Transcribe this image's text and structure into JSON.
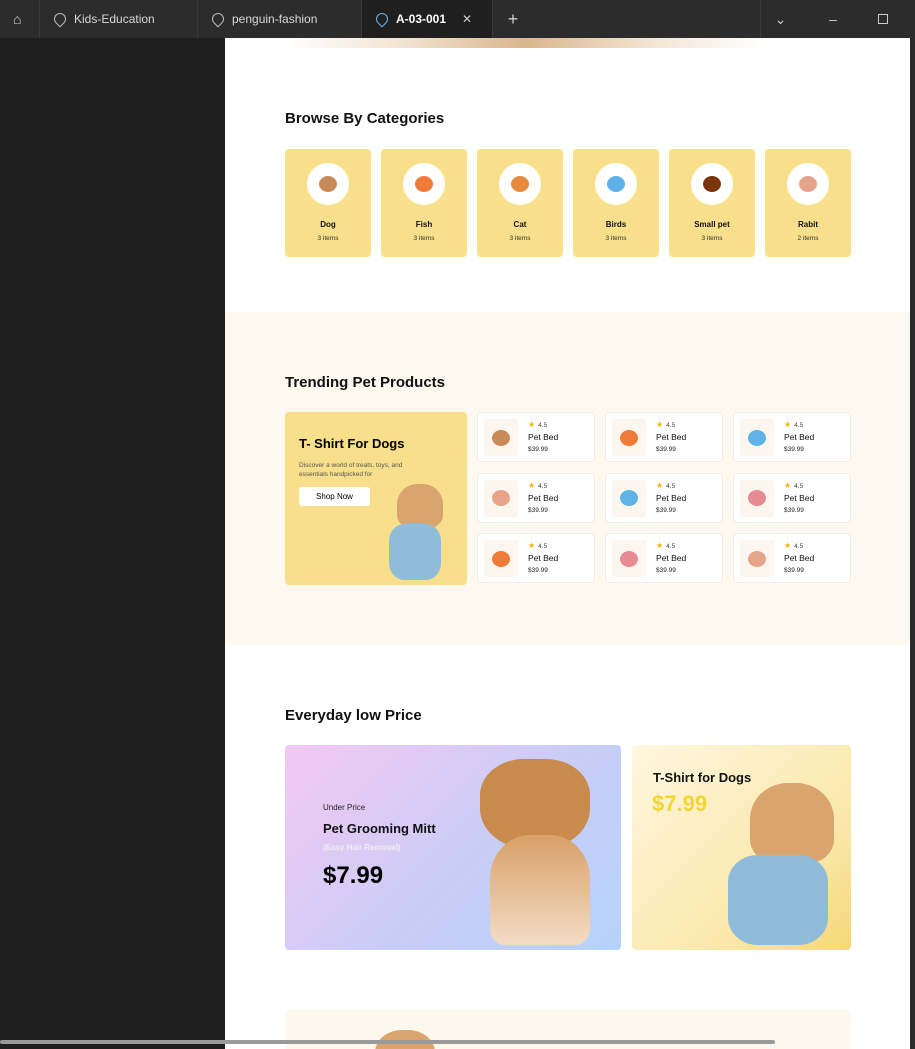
{
  "tabs": [
    {
      "label": "Kids-Education"
    },
    {
      "label": "penguin-fashion"
    },
    {
      "label": "A-03-001",
      "active": true
    }
  ],
  "categories": {
    "title": "Browse By Categories",
    "items": [
      {
        "name": "Dog",
        "count": "3 items",
        "color": "#c98a5a"
      },
      {
        "name": "Fish",
        "count": "3 items",
        "color": "#f07a3a"
      },
      {
        "name": "Cat",
        "count": "3 items",
        "color": "#e88a3c"
      },
      {
        "name": "Birds",
        "count": "3 items",
        "color": "#5fb3e6"
      },
      {
        "name": "Small pet",
        "count": "3 items",
        "color": "#7a3510"
      },
      {
        "name": "Rabit",
        "count": "2 items",
        "color": "#e6a48a"
      }
    ]
  },
  "trending": {
    "title": "Trending Pet Products",
    "banner": {
      "title": "T- Shirt For Dogs",
      "desc": "Discover a world of treats, toys, and essentials handpicked for",
      "button": "Shop Now"
    },
    "products": [
      {
        "name": "Pet Bed",
        "rating": "4.5",
        "price": "$39.99",
        "icon": "dog",
        "color": "#c98a5a"
      },
      {
        "name": "Pet Bed",
        "rating": "4.5",
        "price": "$39.99",
        "icon": "fish",
        "color": "#f07a3a"
      },
      {
        "name": "Pet Bed",
        "rating": "4.5",
        "price": "$39.99",
        "icon": "bird",
        "color": "#5fb3e6"
      },
      {
        "name": "Pet Bed",
        "rating": "4.5",
        "price": "$39.99",
        "icon": "rabbit",
        "color": "#e6a48a"
      },
      {
        "name": "Pet Bed",
        "rating": "4.5",
        "price": "$39.99",
        "icon": "bird",
        "color": "#5fb3e6"
      },
      {
        "name": "Pet Bed",
        "rating": "4.5",
        "price": "$39.99",
        "icon": "bed",
        "color": "#e88a94"
      },
      {
        "name": "Pet Bed",
        "rating": "4.5",
        "price": "$39.99",
        "icon": "fish",
        "color": "#f07a3a"
      },
      {
        "name": "Pet Bed",
        "rating": "4.5",
        "price": "$39.99",
        "icon": "bed",
        "color": "#e88a94"
      },
      {
        "name": "Pet Bed",
        "rating": "4.5",
        "price": "$39.99",
        "icon": "rabbit",
        "color": "#e6a48a"
      }
    ]
  },
  "everyday": {
    "title": "Everyday low Price",
    "deal1": {
      "eyebrow": "Under Price",
      "title": "Pet Grooming Mitt",
      "subtitle": "(Easy Hair Removal)",
      "price": "$7.99"
    },
    "deal2": {
      "title": "T-Shirt for Dogs",
      "price": "$7.99"
    }
  }
}
